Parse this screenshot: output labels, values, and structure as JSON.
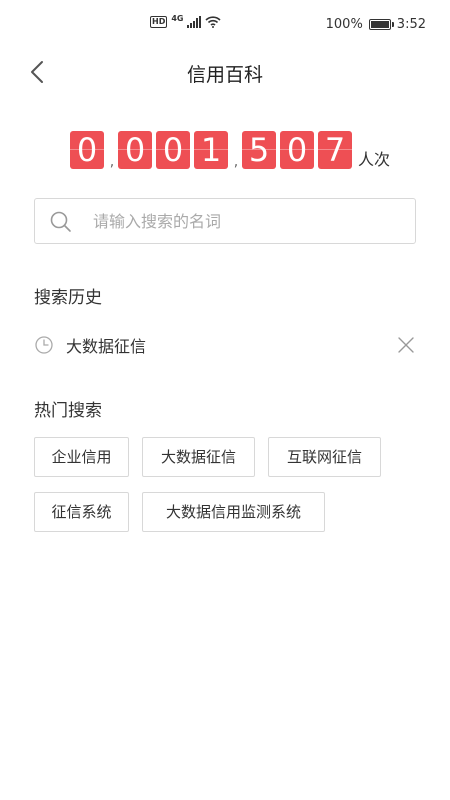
{
  "status_bar": {
    "hd": "HD",
    "network": "4G",
    "battery_percent": "100%",
    "battery_level": 1.0,
    "time": "3:52"
  },
  "header": {
    "title": "信用百科",
    "back_icon": "chevron-left-icon"
  },
  "counter": {
    "digits": [
      "0",
      "0",
      "0",
      "1",
      "5",
      "0",
      "7"
    ],
    "separator": ",",
    "unit": "人次"
  },
  "search": {
    "placeholder": "请输入搜索的名词",
    "value": "",
    "icon": "search-icon"
  },
  "history": {
    "title": "搜索历史",
    "items": [
      {
        "label": "大数据征信",
        "icon": "clock-icon"
      }
    ],
    "clear_icon": "close-icon"
  },
  "hot": {
    "title": "热门搜索",
    "tags": [
      "企业信用",
      "大数据征信",
      "互联网征信",
      "征信系统",
      "大数据信用监测系统"
    ]
  },
  "colors": {
    "digit_bg": "#ee4f54",
    "border": "#d8d8d8",
    "text": "#333333",
    "placeholder": "#aaaaaa"
  }
}
